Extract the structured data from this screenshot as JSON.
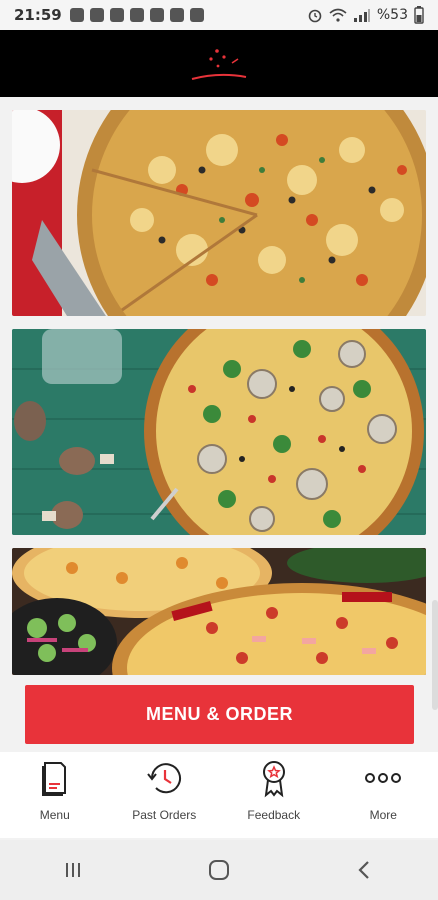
{
  "status_bar": {
    "time": "21:59",
    "battery": "%53"
  },
  "header": {
    "logo": "brand-logo"
  },
  "banners": [
    {
      "name": "pizza-promo-1"
    },
    {
      "name": "pizza-promo-2"
    },
    {
      "name": "pizza-promo-3"
    }
  ],
  "cta": {
    "label": "MENU & ORDER",
    "color": "#e8333a"
  },
  "tabs": [
    {
      "label": "Menu",
      "icon": "menu-book-icon"
    },
    {
      "label": "Past Orders",
      "icon": "history-clock-icon"
    },
    {
      "label": "Feedback",
      "icon": "award-ribbon-icon"
    },
    {
      "label": "More",
      "icon": "more-dots-icon"
    }
  ],
  "colors": {
    "accent": "#e8333a",
    "header_bg": "#000000"
  }
}
